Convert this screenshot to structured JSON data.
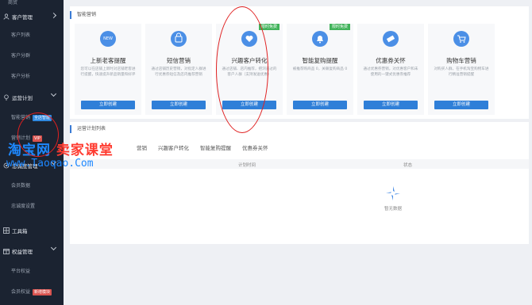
{
  "sidebar": {
    "top_item": "商贸",
    "groups": [
      {
        "label": "客户管理",
        "items": [
          "客户列表",
          "客户分群",
          "客户分析"
        ]
      },
      {
        "label": "运营计划",
        "items": [
          {
            "label": "智能营销",
            "tag": "全店智能"
          },
          {
            "label": "营销计划",
            "tag": "VIP"
          }
        ]
      },
      {
        "label": "忠诚度管理",
        "items": [
          "会员数据",
          "忠诚度设置"
        ]
      },
      {
        "label": "工具箱",
        "items": []
      },
      {
        "label": "权益管理",
        "items": [
          "平台权益",
          {
            "label": "会员权益",
            "tag": "新增模块"
          }
        ]
      }
    ]
  },
  "main": {
    "section_title": "智能营销",
    "cards": [
      {
        "title": "上新老客提醒",
        "icon": "NEW",
        "desc": "您可以在店铺上新时对店铺老客进行提醒，快速提升新品销量和好评",
        "button": "立即创建",
        "flag": ""
      },
      {
        "title": "短信营销",
        "icon": "🔒",
        "desc": "通过店铺历史营销，对指定人群进行优惠券短信及店内推荐营销",
        "button": "立即创建",
        "flag": ""
      },
      {
        "title": "兴趣客户转化",
        "icon": "♥",
        "desc": "通过店铺、店内推荐，把浏览过的客户人群（支持发送优惠）",
        "button": "立即创建",
        "flag": "限时免费"
      },
      {
        "title": "智能复购提醒",
        "icon": "▲",
        "desc": "被推荐购商品 0，关联复购商品 0",
        "button": "立即创建",
        "flag": "限时免费"
      },
      {
        "title": "优惠券关怀",
        "icon": "✎",
        "desc": "通过优惠券营销，对优惠客户和未使用的一键式优惠券推荐",
        "button": "立即创建",
        "flag": ""
      },
      {
        "title": "购物车营销",
        "icon": "🛒",
        "desc": "对购买人群，在手机淘宝购物车进行精准营销提醒",
        "button": "立即创建",
        "flag": ""
      }
    ]
  },
  "plan_list": {
    "section_title": "运营计划列表",
    "tabs": [
      "营销",
      "兴趣客户转化",
      "智能复购提醒",
      "优惠券关怀"
    ],
    "columns": [
      "计划时间",
      "状态"
    ],
    "empty_text": "暂无数据"
  },
  "watermark": {
    "line1_a": "淘宝网",
    "line1_b": "卖家课堂",
    "line2": "www.Taoqao.Com"
  },
  "colors": {
    "sidebar_bg": "#1b2331",
    "primary": "#2f7fd8",
    "free_flag": "#41b35a",
    "annotation": "#e02020"
  }
}
